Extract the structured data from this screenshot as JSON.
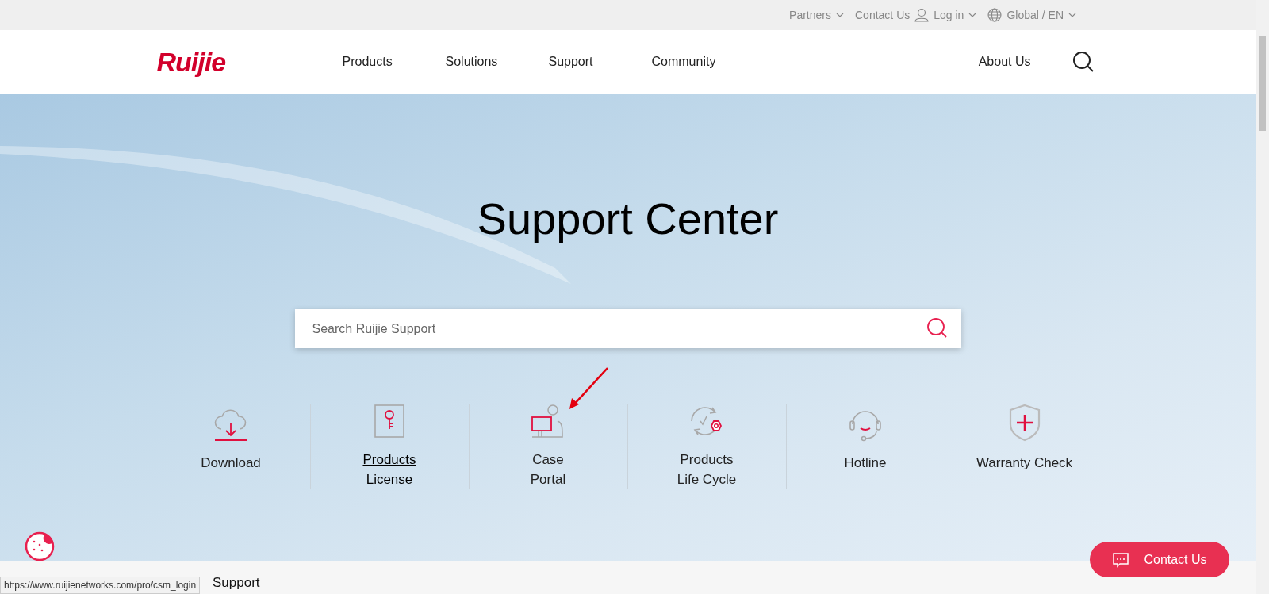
{
  "top_bar": {
    "links": [
      {
        "label": "Partners",
        "dropdown": true,
        "kind": "plain"
      },
      {
        "label": "Contact Us",
        "dropdown": false,
        "kind": "plain"
      },
      {
        "label": "Log in",
        "dropdown": true,
        "kind": "user"
      },
      {
        "label": "Global / EN",
        "dropdown": true,
        "kind": "globe"
      }
    ]
  },
  "header": {
    "logo": "Ruijie",
    "nav": [
      "Products",
      "Solutions",
      "Support",
      "Community"
    ],
    "about": "About Us"
  },
  "hero": {
    "title": "Support Center",
    "search": {
      "placeholder": "Search Ruijie Support"
    }
  },
  "services": [
    {
      "kind": "download",
      "label": [
        "Download"
      ],
      "underlined": false
    },
    {
      "kind": "license",
      "label": [
        "Products",
        "License"
      ],
      "underlined": true
    },
    {
      "kind": "case",
      "label": [
        "Case",
        "Portal"
      ],
      "underlined": false
    },
    {
      "kind": "lifecycle",
      "label": [
        "Products",
        "Life Cycle"
      ],
      "underlined": false
    },
    {
      "kind": "hotline",
      "label": [
        "Hotline"
      ],
      "underlined": false
    },
    {
      "kind": "warranty",
      "label": [
        "Warranty Check"
      ],
      "underlined": false
    }
  ],
  "section_heading": "Support",
  "contact_button": "Contact Us",
  "status_url": "https://www.ruijienetworks.com/pro/csm_login"
}
